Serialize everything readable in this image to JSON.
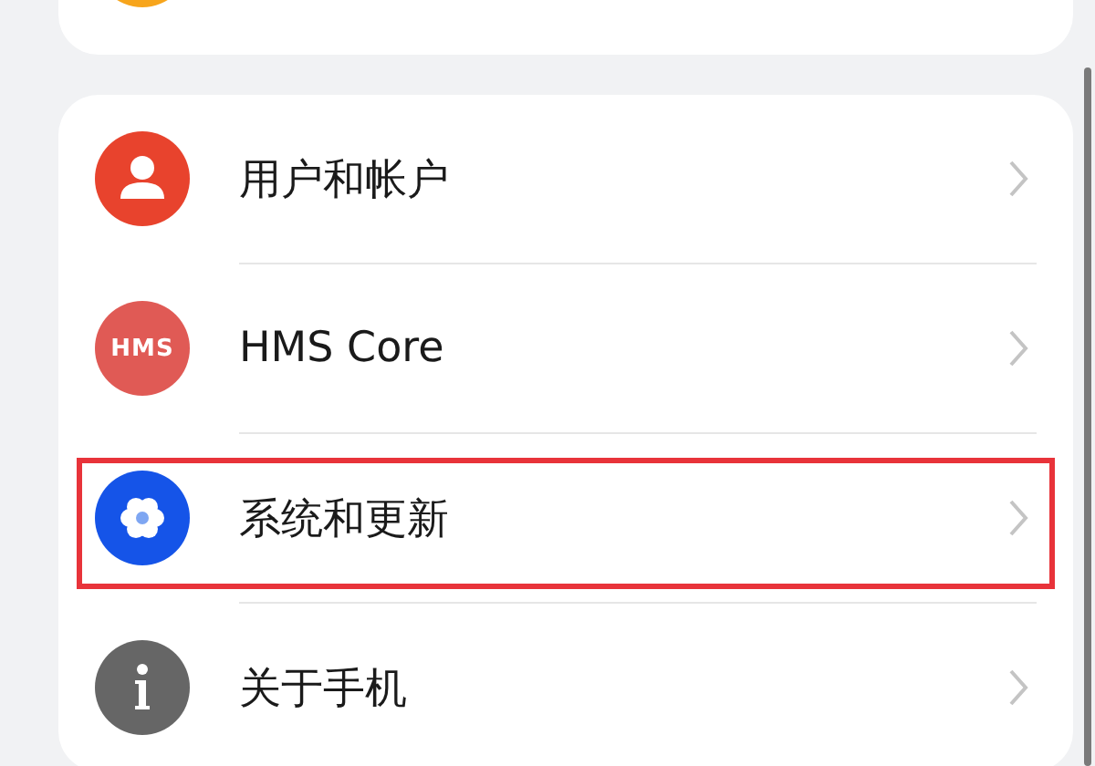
{
  "groups": [
    {
      "items": [
        {
          "kind": "circle",
          "color": "#f7a51c"
        }
      ]
    },
    {
      "items": [
        {
          "kind": "person",
          "label": "用户和帐户",
          "color": "#e8432d",
          "highlighted": false
        },
        {
          "kind": "hms",
          "label": "HMS Core",
          "icon_text": "HMS",
          "color": "#e05a55",
          "highlighted": false
        },
        {
          "kind": "gear",
          "label": "系统和更新",
          "color": "#1554e8",
          "highlighted": true
        },
        {
          "kind": "info",
          "label": "关于手机",
          "color": "#666666",
          "highlighted": false
        }
      ]
    }
  ]
}
